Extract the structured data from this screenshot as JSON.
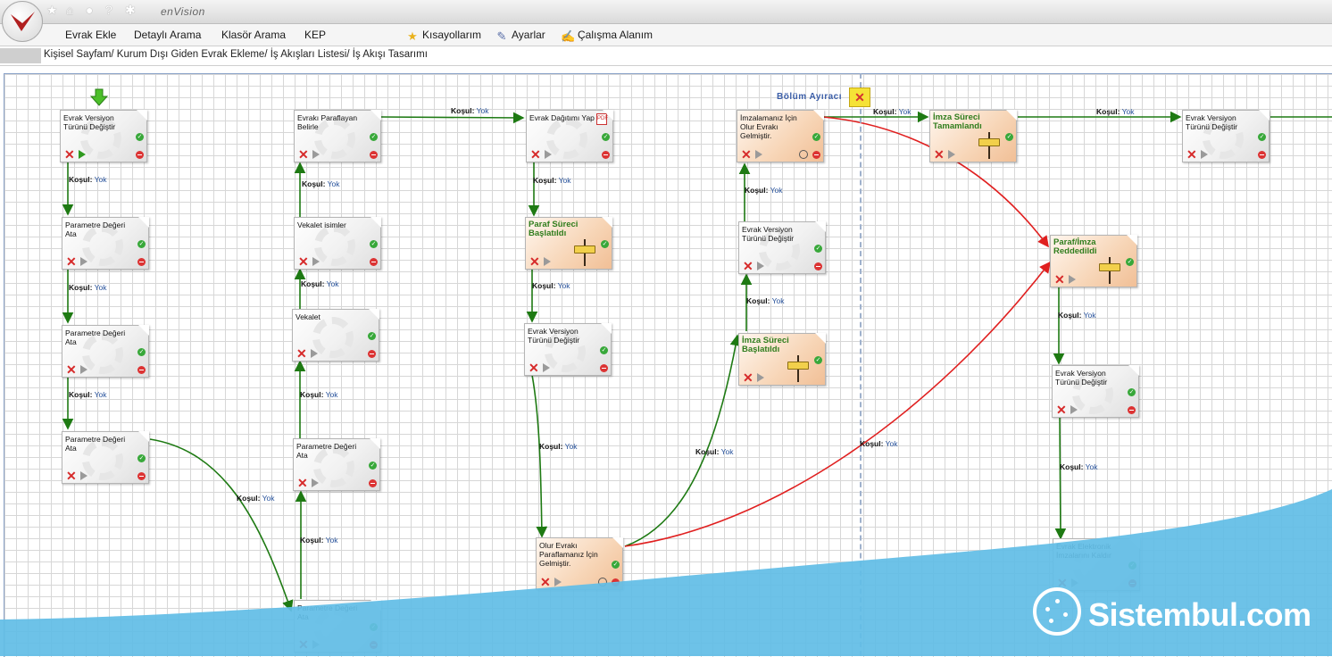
{
  "app": {
    "brand": "enVision",
    "quick_icons": [
      "star-icon",
      "home-icon",
      "user-icon",
      "help-icon",
      "puzzle-icon"
    ]
  },
  "menu": {
    "items": [
      {
        "label": "Evrak Ekle"
      },
      {
        "label": "Detaylı Arama"
      },
      {
        "label": "Klasör Arama"
      },
      {
        "label": "KEP"
      }
    ],
    "right_items": [
      {
        "label": "Kısayollarım",
        "icon": "star-icon"
      },
      {
        "label": "Ayarlar",
        "icon": "settings-icon"
      },
      {
        "label": "Çalışma Alanım",
        "icon": "workspace-icon"
      }
    ]
  },
  "breadcrumb": "Kişisel Sayfam/ Kurum Dışı Giden Evrak Ekleme/ İş Akışları Listesi/ İş Akışı Tasarımı",
  "section": {
    "title": "Bölüm Ayıracı"
  },
  "condition": {
    "key": "Koşul:",
    "value": "Yok"
  },
  "nodes": [
    {
      "title": "Evrak Versiyon Türünü Değiştir"
    },
    {
      "title": "Parametre Değeri Ata"
    },
    {
      "title": "Parametre Değeri Ata"
    },
    {
      "title": "Parametre Değeri Ata"
    },
    {
      "title": "Evrakı Paraflayan Belirle"
    },
    {
      "title": "Vekalet isimler"
    },
    {
      "title": "Vekalet"
    },
    {
      "title": "Parametre Değeri Ata"
    },
    {
      "title": "Parametre Değeri Ata"
    },
    {
      "title": "Evrak Dağıtımı Yap"
    },
    {
      "title": "Paraf Süreci Başlatıldı"
    },
    {
      "title": "Evrak Versiyon Türünü Değiştir"
    },
    {
      "title": "Olur Evrakı Paraflamanız İçin Gelmiştir."
    },
    {
      "title": "İmzalamanız İçin Olur Evrakı Gelmiştir."
    },
    {
      "title": "Evrak Versiyon Türünü Değiştir"
    },
    {
      "title": "İmza Süreci Başlatıldı"
    },
    {
      "title": "İmza Süreci Tamamlandı"
    },
    {
      "title": "Evrak Versiyon Türünü Değiştir"
    },
    {
      "title": "Paraf/İmza Reddedildi"
    },
    {
      "title": "Evrak Versiyon Türünü Değiştir"
    },
    {
      "title": "Evrak Elektronik İmzalarını Kaldır"
    }
  ],
  "watermark": "Sistembul.com",
  "colors": {
    "accept_edge": "#1e7a13",
    "reject_edge": "#e02020",
    "watermark_bg": "#62bde6",
    "section_title": "#3b5ea8"
  }
}
